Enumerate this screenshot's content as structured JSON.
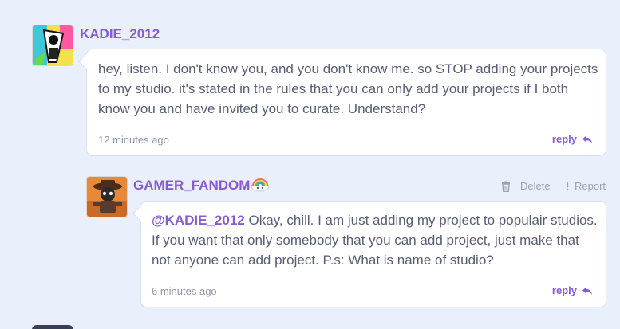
{
  "comments": [
    {
      "username": "KADIE_2012",
      "text": "hey, listen. I don't know you, and you don't know me. so STOP adding your projects to my studio. it's stated in the rules that you can only add your projects if I both know you and have invited you to curate. Understand?",
      "time": "12 minutes ago",
      "reply_label": "reply"
    },
    {
      "username": "GAMER_FANDOM",
      "mention": "@KADIE_2012",
      "text": "Okay, chill. I am just adding my project to populair studios. If you want that only somebody that you can add project, just make that not anyone can add project. P.s: What is name of studio?",
      "time": "6 minutes ago",
      "reply_label": "reply",
      "delete_label": "Delete",
      "report_label": "Report"
    }
  ],
  "colors": {
    "accent": "#855cd6",
    "background": "#e9f0fc",
    "text": "#575e75",
    "muted": "#8e96a8"
  },
  "icons": {
    "reply": "reply-arrow-icon",
    "delete": "trash-icon",
    "report": "exclamation-icon",
    "badge": "rainbow-badge-icon"
  }
}
